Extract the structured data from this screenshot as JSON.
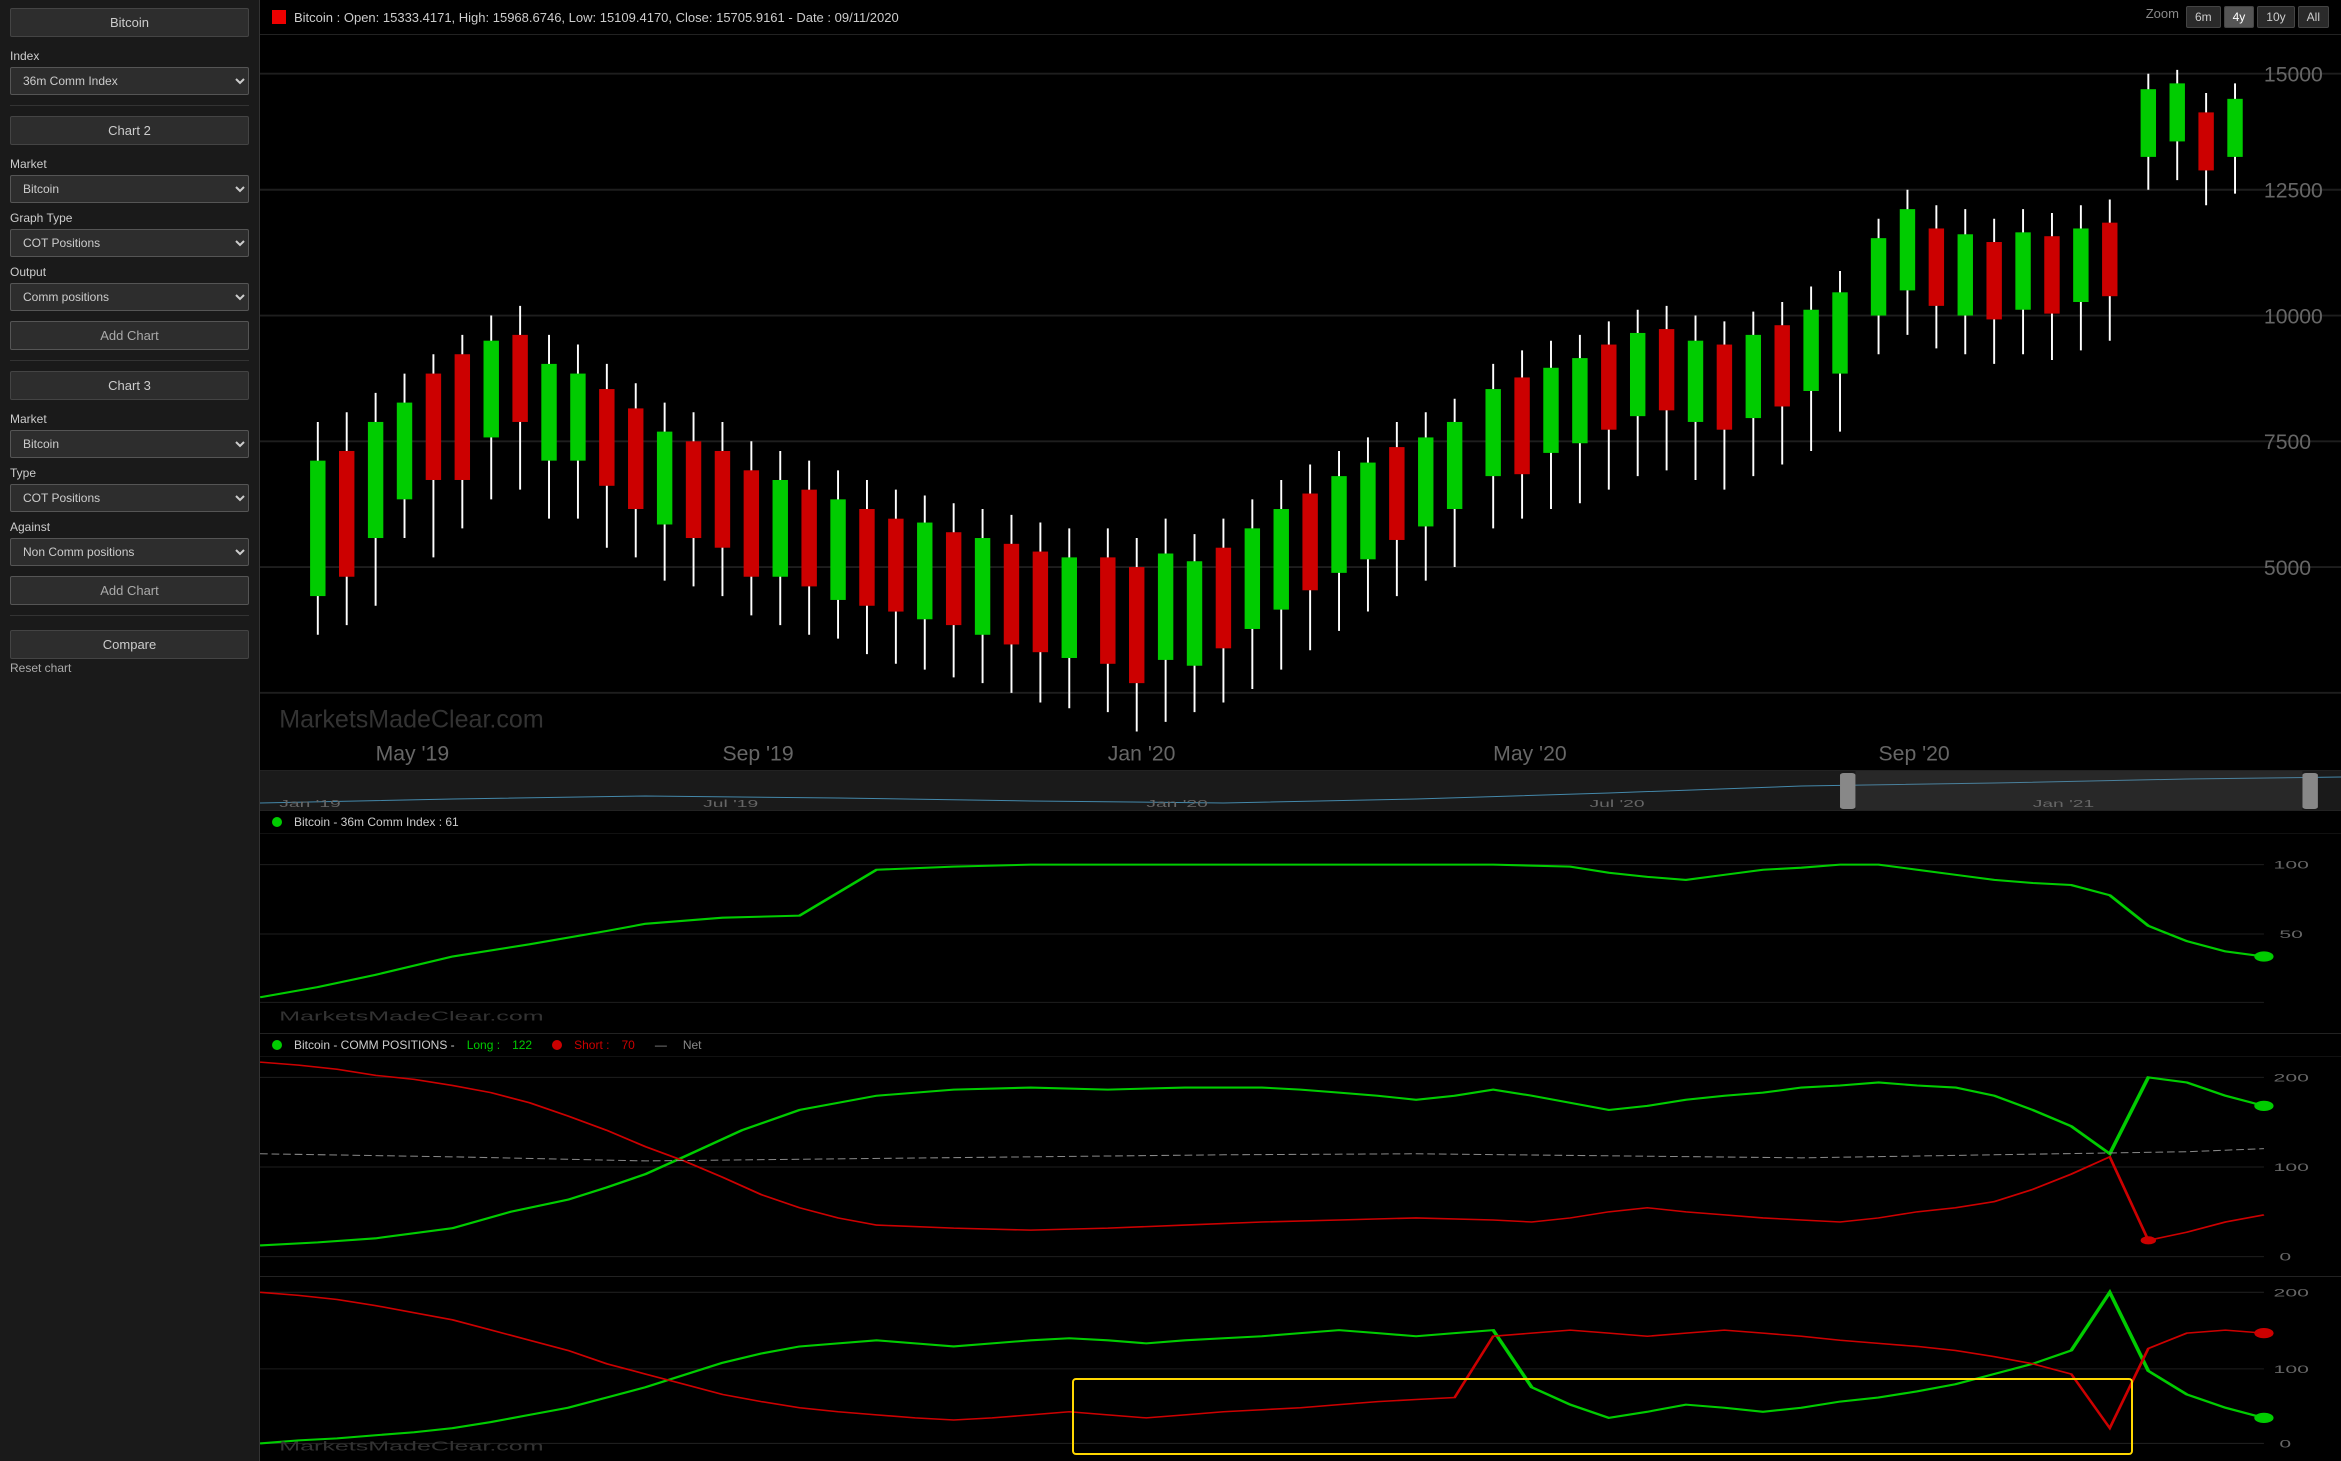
{
  "sidebar": {
    "chart1": {
      "title": "Bitcoin",
      "index_label": "Index",
      "index_value": "36m Comm Index"
    },
    "chart2": {
      "title": "Chart 2",
      "market_label": "Market",
      "market_value": "Bitcoin",
      "graph_type_label": "Graph Type",
      "graph_type_value": "COT Positions",
      "output_label": "Output",
      "output_value": "Comm positions",
      "add_chart_btn": "Add Chart"
    },
    "chart3": {
      "title": "Chart 3",
      "market_label": "Market",
      "market_value": "Bitcoin",
      "type_label": "Type",
      "type_value": "COT Positions",
      "against_label": "Against",
      "against_value": "Non Comm positions",
      "add_chart_btn": "Add Chart"
    },
    "compare": {
      "title": "Compare",
      "reset_label": "Reset chart"
    }
  },
  "chart_header": {
    "price_info": "Bitcoin : Open: 15333.4171, High: 15968.6746, Low: 15109.4170, Close: 15705.9161 - Date : 09/11/2020",
    "zoom_label": "Zoom",
    "zoom_options": [
      "6m",
      "4y",
      "10y",
      "All"
    ],
    "active_zoom": "4y"
  },
  "index_legend": {
    "text": "Bitcoin - 36m Comm Index : 61",
    "color": "#00cc00"
  },
  "cot_legend": {
    "long_label": "Long",
    "long_value": "122",
    "short_label": "Short",
    "short_value": "70",
    "net_label": "Net",
    "prefix": "Bitcoin - COMM POSITIONS -",
    "long_color": "#00cc00",
    "short_color": "#cc0000",
    "net_color": "#888"
  },
  "x_axis": {
    "labels": [
      "May '19",
      "Sep '19",
      "Jan '20",
      "May '20",
      "Sep '20"
    ]
  },
  "y_axis_price": {
    "labels": [
      "15000.00",
      "12500.00",
      "10000.00",
      "7500.00",
      "5000.00"
    ]
  },
  "y_axis_index": {
    "labels": [
      "100",
      "50"
    ]
  },
  "y_axis_cot": {
    "labels": [
      "200",
      "100",
      "0"
    ]
  },
  "watermark": "MarketsMadeClear.com",
  "navigator": {
    "labels": [
      "Jan '19",
      "Jul '19",
      "Jan '20",
      "Jul '20",
      "Jan '21"
    ]
  }
}
